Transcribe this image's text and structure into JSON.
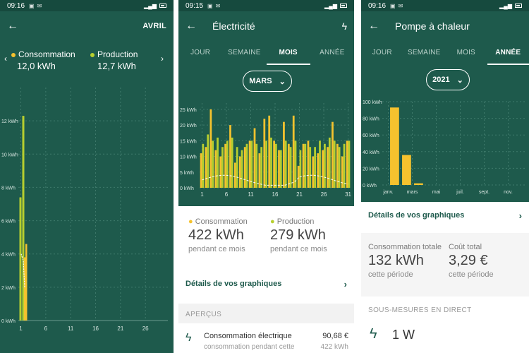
{
  "screen1": {
    "status": {
      "time": "09:16"
    },
    "appbar": {
      "action": "AVRIL"
    },
    "summary": {
      "consumption": {
        "label": "Consommation",
        "value": "12,0 kWh"
      },
      "production": {
        "label": "Production",
        "value": "12,7 kWh"
      }
    },
    "chart_data": {
      "type": "bar",
      "yticks": [
        "0 kWh",
        "2 kWh",
        "4 kWh",
        "6 kWh",
        "8 kWh",
        "10 kWh",
        "12 kWh"
      ],
      "xticks": [
        "1",
        "6",
        "11",
        "16",
        "21",
        "26"
      ],
      "ylim": [
        0,
        14
      ],
      "series": [
        {
          "name": "Production",
          "values": [
            7.4,
            12.3
          ]
        },
        {
          "name": "Consommation",
          "values": [
            3.8,
            4.6
          ]
        }
      ]
    }
  },
  "screen2": {
    "status": {
      "time": "09:15"
    },
    "appbar": {
      "title": "Électricité"
    },
    "tabs": [
      "JOUR",
      "SEMAINE",
      "MOIS",
      "ANNÉE"
    ],
    "active_tab": "MOIS",
    "selector": "MARS",
    "chart_data": {
      "type": "bar",
      "yticks": [
        "0 kWh",
        "5 kWh",
        "10 kWh",
        "15 kWh",
        "20 kWh",
        "25 kWh"
      ],
      "xticks": [
        "1",
        "6",
        "11",
        "16",
        "21",
        "26",
        "31"
      ],
      "ylim": [
        0,
        27
      ],
      "series": [
        {
          "name": "Production",
          "values": [
            11,
            13,
            25,
            12,
            10,
            14,
            20,
            8,
            10,
            13,
            15,
            19,
            11,
            22,
            23,
            15,
            12,
            21,
            14,
            23,
            7,
            14,
            15,
            10,
            11,
            12,
            13,
            21,
            14,
            10,
            15
          ]
        },
        {
          "name": "Consommation",
          "values": [
            14,
            17,
            15,
            16,
            13,
            15,
            16,
            13,
            12,
            14,
            15,
            14,
            13,
            15,
            16,
            14,
            12,
            15,
            13,
            15,
            12,
            14,
            13,
            13,
            15,
            14,
            16,
            15,
            13,
            14,
            15
          ]
        }
      ]
    },
    "summary": {
      "consumption": {
        "label": "Consommation",
        "value": "422 kWh",
        "sub": "pendant ce mois"
      },
      "production": {
        "label": "Production",
        "value": "279 kWh",
        "sub": "pendant ce mois"
      }
    },
    "details_link": "Détails de vos graphiques",
    "overview": {
      "heading": "APERÇUS",
      "item": {
        "title": "Consommation électrique",
        "amount": "90,68 €",
        "sub": "consommation pendant cette",
        "sub_value": "422 kWh"
      }
    }
  },
  "screen3": {
    "status": {
      "time": "09:16"
    },
    "appbar": {
      "title": "Pompe à chaleur"
    },
    "tabs": [
      "JOUR",
      "SEMAINE",
      "MOIS",
      "ANNÉE"
    ],
    "active_tab": "ANNÉE",
    "selector": "2021",
    "chart_data": {
      "type": "bar",
      "yticks": [
        "0 kWh",
        "20 kWh",
        "40 kWh",
        "60 kWh",
        "80 kWh",
        "100 kWh"
      ],
      "xticks": [
        "janv.",
        "mars",
        "mai",
        "juil.",
        "sept.",
        "nov."
      ],
      "ylim": [
        0,
        100
      ],
      "series": [
        {
          "name": "Consommation",
          "values": [
            0,
            93,
            36,
            2,
            0,
            0,
            0,
            0,
            0,
            0,
            0,
            0,
            0
          ]
        }
      ]
    },
    "details_link": "Détails de vos graphiques",
    "totals": {
      "consumption": {
        "label": "Consommation totale",
        "value": "132 kWh",
        "sub": "cette période"
      },
      "cost": {
        "label": "Coût total",
        "value": "3,29 €",
        "sub": "cette période"
      }
    },
    "live": {
      "heading": "SOUS-MESURES EN DIRECT",
      "value": "1 W"
    }
  },
  "colors": {
    "brand": "#1e5a4c",
    "production": "#b7cf2f",
    "consumption": "#f5c22e"
  }
}
